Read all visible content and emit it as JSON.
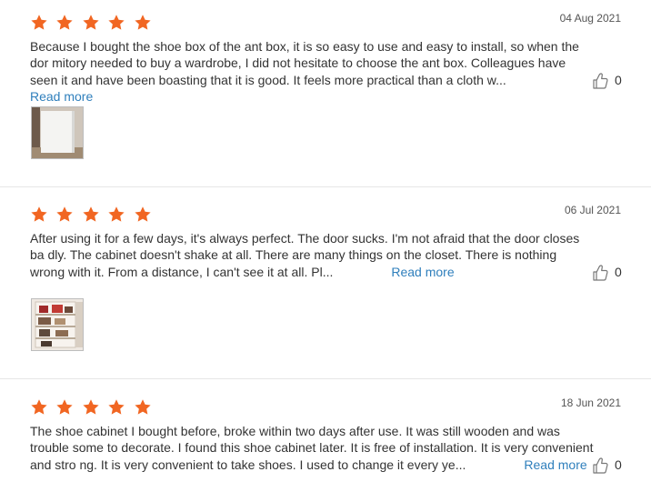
{
  "colors": {
    "star": "#f16622",
    "link": "#2f7fbc",
    "text": "#333333",
    "divider": "#e6e6e6"
  },
  "reviews": [
    {
      "rating": 5,
      "date": "04 Aug 2021",
      "text": "Because I bought the shoe box of the ant box, it is so easy to use and easy to install, so when the dor mitory needed to buy a wardrobe, I did not hesitate to choose the ant box. Colleagues have seen it and have been boasting that it is good. It feels more practical than a cloth w...",
      "read_more": "Read more",
      "likes": "0",
      "photo": "wardrobe-photo"
    },
    {
      "rating": 5,
      "date": "06 Jul 2021",
      "text": "After using it for a few days, it's always perfect. The door sucks. I'm not afraid that the door closes ba dly. The cabinet doesn't shake at all. There are many things on the closet. There is nothing wrong with it. From a distance, I can't see it at all. Pl...",
      "read_more": "Read more",
      "likes": "0",
      "photo": "shoe-cabinet-photo"
    },
    {
      "rating": 5,
      "date": "18 Jun 2021",
      "text": "The shoe cabinet I bought before, broke within two days after use. It was still wooden and was trouble some to decorate. I found this shoe cabinet later. It is free of installation. It is very convenient and stro ng. It is very convenient to take shoes. I used to change it every ye...",
      "read_more": "Read more",
      "likes": "0"
    }
  ]
}
